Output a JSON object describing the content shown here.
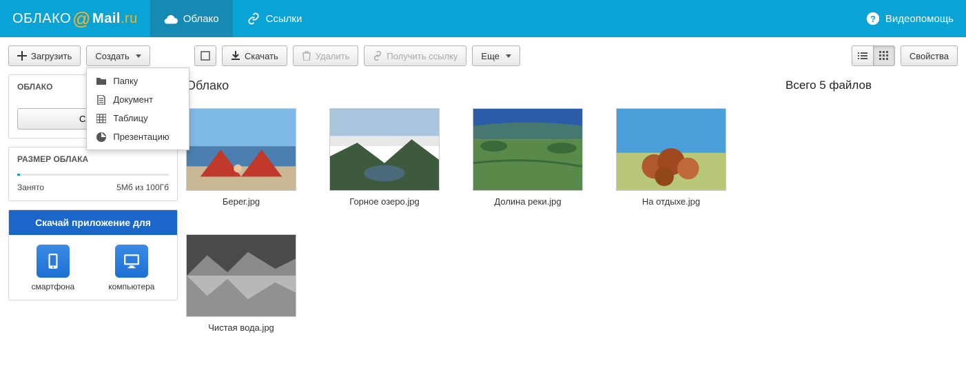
{
  "header": {
    "logo": {
      "cloud": "ОБЛАКО",
      "mail": "Mail",
      "ru": ".ru"
    },
    "tabs": [
      {
        "label": "Облако",
        "active": true
      },
      {
        "label": "Ссылки",
        "active": false
      }
    ],
    "help": "Видеопомощь"
  },
  "topbar": {
    "upload": "Загрузить",
    "create": "Создать",
    "create_menu": [
      {
        "label": "Папку",
        "icon": "folder"
      },
      {
        "label": "Документ",
        "icon": "doc"
      },
      {
        "label": "Таблицу",
        "icon": "table"
      },
      {
        "label": "Презентацию",
        "icon": "pres"
      }
    ],
    "download": "Скачать",
    "delete": "Удалить",
    "get_link": "Получить ссылку",
    "more": "Еще",
    "properties": "Свойства"
  },
  "sidebar": {
    "cloud_title": "ОБЛАКО",
    "service_btn": "Служб",
    "size_title": "РАЗМЕР ОБЛАКА",
    "used_label": "Занято",
    "used_value": "5Мб из 100Гб",
    "promo_title": "Скачай приложение для",
    "promo_phone": "смартфона",
    "promo_pc": "компьютера"
  },
  "content": {
    "breadcrumb": "Облако",
    "files": [
      {
        "name": "Берег.jpg"
      },
      {
        "name": "Горное озеро.jpg"
      },
      {
        "name": "Долина реки.jpg"
      },
      {
        "name": "На отдыхе.jpg"
      },
      {
        "name": "Чистая вода.jpg"
      }
    ]
  },
  "right": {
    "total": "Всего 5 файлов"
  }
}
